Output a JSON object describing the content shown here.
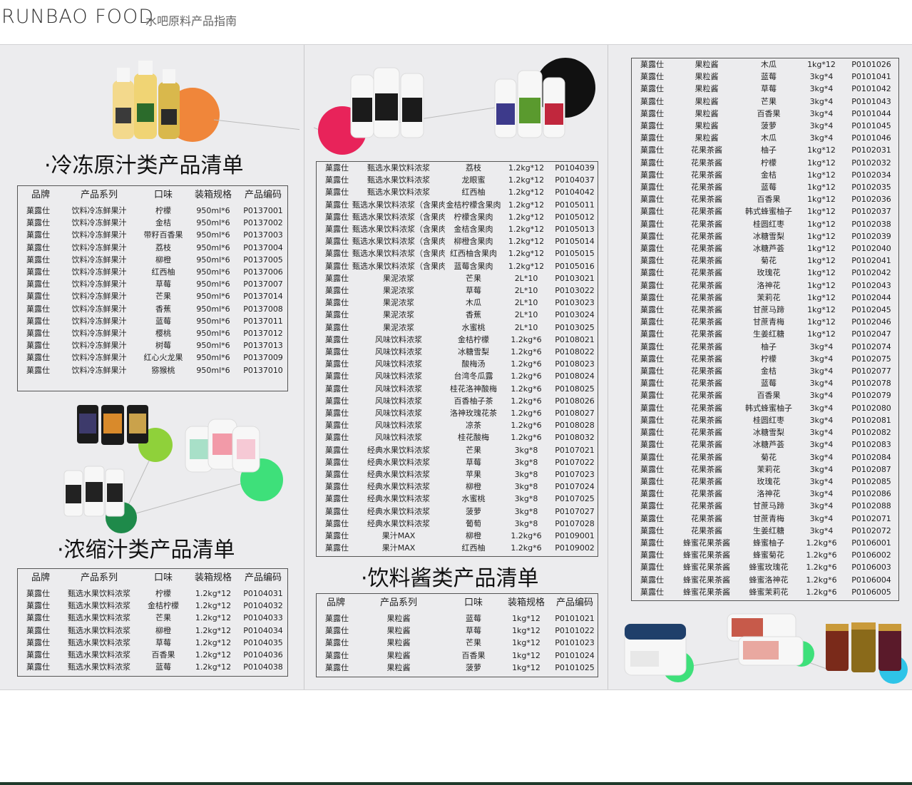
{
  "header": {
    "brand": "RUNBAO FOOD",
    "subtitle": "水吧原料产品指南"
  },
  "sections": {
    "frozen": {
      "title": "·冷冻原汁类产品清单",
      "headers": [
        "品牌",
        "产品系列",
        "口味",
        "装箱规格",
        "产品编码"
      ],
      "rows": [
        [
          "菓露仕",
          "饮料冷冻鲜果汁",
          "柠檬",
          "950ml*6",
          "P0137001"
        ],
        [
          "菓露仕",
          "饮料冷冻鲜果汁",
          "金桔",
          "950ml*6",
          "P0137002"
        ],
        [
          "菓露仕",
          "饮料冷冻鲜果汁",
          "带籽百香果",
          "950ml*6",
          "P0137003"
        ],
        [
          "菓露仕",
          "饮料冷冻鲜果汁",
          "荔枝",
          "950ml*6",
          "P0137004"
        ],
        [
          "菓露仕",
          "饮料冷冻鲜果汁",
          "柳橙",
          "950ml*6",
          "P0137005"
        ],
        [
          "菓露仕",
          "饮料冷冻鲜果汁",
          "红西柚",
          "950ml*6",
          "P0137006"
        ],
        [
          "菓露仕",
          "饮料冷冻鲜果汁",
          "草莓",
          "950ml*6",
          "P0137007"
        ],
        [
          "菓露仕",
          "饮料冷冻鲜果汁",
          "芒果",
          "950ml*6",
          "P0137014"
        ],
        [
          "菓露仕",
          "饮料冷冻鲜果汁",
          "香蕉",
          "950ml*6",
          "P0137008"
        ],
        [
          "菓露仕",
          "饮料冷冻鲜果汁",
          "蓝莓",
          "950ml*6",
          "P0137011"
        ],
        [
          "菓露仕",
          "饮料冷冻鲜果汁",
          "樱桃",
          "950ml*6",
          "P0137012"
        ],
        [
          "菓露仕",
          "饮料冷冻鲜果汁",
          "树莓",
          "950ml*6",
          "P0137013"
        ],
        [
          "菓露仕",
          "饮料冷冻鲜果汁",
          "红心火龙果",
          "950ml*6",
          "P0137009"
        ],
        [
          "菓露仕",
          "饮料冷冻鲜果汁",
          "猕猴桃",
          "950ml*6",
          "P0137010"
        ]
      ]
    },
    "concentrate": {
      "title": "·浓缩汁类产品清单",
      "headers": [
        "品牌",
        "产品系列",
        "口味",
        "装箱规格",
        "产品编码"
      ],
      "rows": [
        [
          "菓露仕",
          "甄选水果饮料浓浆",
          "柠檬",
          "1.2kg*12",
          "P0104031"
        ],
        [
          "菓露仕",
          "甄选水果饮料浓浆",
          "金桔柠檬",
          "1.2kg*12",
          "P0104032"
        ],
        [
          "菓露仕",
          "甄选水果饮料浓浆",
          "芒果",
          "1.2kg*12",
          "P0104033"
        ],
        [
          "菓露仕",
          "甄选水果饮料浓浆",
          "柳橙",
          "1.2kg*12",
          "P0104034"
        ],
        [
          "菓露仕",
          "甄选水果饮料浓浆",
          "草莓",
          "1.2kg*12",
          "P0104035"
        ],
        [
          "菓露仕",
          "甄选水果饮料浓浆",
          "百香果",
          "1.2kg*12",
          "P0104036"
        ],
        [
          "菓露仕",
          "甄选水果饮料浓浆",
          "蓝莓",
          "1.2kg*12",
          "P0104038"
        ]
      ]
    },
    "middle": {
      "rows": [
        [
          "菓露仕",
          "甄选水果饮料浓浆",
          "荔枝",
          "1.2kg*12",
          "P0104039"
        ],
        [
          "菓露仕",
          "甄选水果饮料浓浆",
          "龙眼蜜",
          "1.2kg*12",
          "P0104037"
        ],
        [
          "菓露仕",
          "甄选水果饮料浓浆",
          "红西柚",
          "1.2kg*12",
          "P0104042"
        ],
        [
          "菓露仕",
          "甄选水果饮料浓浆（含果肉）",
          "金桔柠檬含果肉",
          "1.2kg*12",
          "P0105011"
        ],
        [
          "菓露仕",
          "甄选水果饮料浓浆（含果肉）",
          "柠檬含果肉",
          "1.2kg*12",
          "P0105012"
        ],
        [
          "菓露仕",
          "甄选水果饮料浓浆（含果肉）",
          "金桔含果肉",
          "1.2kg*12",
          "P0105013"
        ],
        [
          "菓露仕",
          "甄选水果饮料浓浆（含果肉）",
          "柳橙含果肉",
          "1.2kg*12",
          "P0105014"
        ],
        [
          "菓露仕",
          "甄选水果饮料浓浆（含果肉）",
          "红西柚含果肉",
          "1.2kg*12",
          "P0105015"
        ],
        [
          "菓露仕",
          "甄选水果饮料浓浆（含果肉）",
          "蓝莓含果肉",
          "1.2kg*12",
          "P0105016"
        ],
        [
          "菓露仕",
          "果泥浓浆",
          "芒果",
          "2L*10",
          "P0103021"
        ],
        [
          "菓露仕",
          "果泥浓浆",
          "草莓",
          "2L*10",
          "P0103022"
        ],
        [
          "菓露仕",
          "果泥浓浆",
          "木瓜",
          "2L*10",
          "P0103023"
        ],
        [
          "菓露仕",
          "果泥浓浆",
          "香蕉",
          "2L*10",
          "P0103024"
        ],
        [
          "菓露仕",
          "果泥浓浆",
          "水蜜桃",
          "2L*10",
          "P0103025"
        ],
        [
          "菓露仕",
          "风味饮料浓浆",
          "金桔柠檬",
          "1.2kg*6",
          "P0108021"
        ],
        [
          "菓露仕",
          "风味饮料浓浆",
          "冰糖雪梨",
          "1.2kg*6",
          "P0108022"
        ],
        [
          "菓露仕",
          "风味饮料浓浆",
          "酸梅汤",
          "1.2kg*6",
          "P0108023"
        ],
        [
          "菓露仕",
          "风味饮料浓浆",
          "台湾冬瓜露",
          "1.2kg*6",
          "P0108024"
        ],
        [
          "菓露仕",
          "风味饮料浓浆",
          "桂花洛神酸梅",
          "1.2kg*6",
          "P0108025"
        ],
        [
          "菓露仕",
          "风味饮料浓浆",
          "百香柚子茶",
          "1.2kg*6",
          "P0108026"
        ],
        [
          "菓露仕",
          "风味饮料浓浆",
          "洛神玫瑰花茶",
          "1.2kg*6",
          "P0108027"
        ],
        [
          "菓露仕",
          "风味饮料浓浆",
          "凉茶",
          "1.2kg*6",
          "P0108028"
        ],
        [
          "菓露仕",
          "风味饮料浓浆",
          "桂花酸梅",
          "1.2kg*6",
          "P0108032"
        ],
        [
          "菓露仕",
          "经典水果饮料浓浆",
          "芒果",
          "3kg*8",
          "P0107021"
        ],
        [
          "菓露仕",
          "经典水果饮料浓浆",
          "草莓",
          "3kg*8",
          "P0107022"
        ],
        [
          "菓露仕",
          "经典水果饮料浓浆",
          "苹果",
          "3kg*8",
          "P0107023"
        ],
        [
          "菓露仕",
          "经典水果饮料浓浆",
          "柳橙",
          "3kg*8",
          "P0107024"
        ],
        [
          "菓露仕",
          "经典水果饮料浓浆",
          "水蜜桃",
          "3kg*8",
          "P0107025"
        ],
        [
          "菓露仕",
          "经典水果饮料浓浆",
          "菠萝",
          "3kg*8",
          "P0107027"
        ],
        [
          "菓露仕",
          "经典水果饮料浓浆",
          "葡萄",
          "3kg*8",
          "P0107028"
        ],
        [
          "菓露仕",
          "果汁MAX",
          "柳橙",
          "1.2kg*6",
          "P0109001"
        ],
        [
          "菓露仕",
          "果汁MAX",
          "红西柚",
          "1.2kg*6",
          "P0109002"
        ]
      ]
    },
    "sauce": {
      "title": "·饮料酱类产品清单",
      "headers": [
        "品牌",
        "产品系列",
        "口味",
        "装箱规格",
        "产品编码"
      ],
      "rows": [
        [
          "菓露仕",
          "果粒酱",
          "蓝莓",
          "1kg*12",
          "P0101021"
        ],
        [
          "菓露仕",
          "果粒酱",
          "草莓",
          "1kg*12",
          "P0101022"
        ],
        [
          "菓露仕",
          "果粒酱",
          "芒果",
          "1kg*12",
          "P0101023"
        ],
        [
          "菓露仕",
          "果粒酱",
          "百香果",
          "1kg*12",
          "P0101024"
        ],
        [
          "菓露仕",
          "果粒酱",
          "菠萝",
          "1kg*12",
          "P0101025"
        ]
      ]
    },
    "right": {
      "rows": [
        [
          "菓露仕",
          "果粒酱",
          "木瓜",
          "1kg*12",
          "P0101026"
        ],
        [
          "菓露仕",
          "果粒酱",
          "蓝莓",
          "3kg*4",
          "P0101041"
        ],
        [
          "菓露仕",
          "果粒酱",
          "草莓",
          "3kg*4",
          "P0101042"
        ],
        [
          "菓露仕",
          "果粒酱",
          "芒果",
          "3kg*4",
          "P0101043"
        ],
        [
          "菓露仕",
          "果粒酱",
          "百香果",
          "3kg*4",
          "P0101044"
        ],
        [
          "菓露仕",
          "果粒酱",
          "菠萝",
          "3kg*4",
          "P0101045"
        ],
        [
          "菓露仕",
          "果粒酱",
          "木瓜",
          "3kg*4",
          "P0101046"
        ],
        [
          "菓露仕",
          "花果茶酱",
          "柚子",
          "1kg*12",
          "P0102031"
        ],
        [
          "菓露仕",
          "花果茶酱",
          "柠檬",
          "1kg*12",
          "P0102032"
        ],
        [
          "菓露仕",
          "花果茶酱",
          "金桔",
          "1kg*12",
          "P0102034"
        ],
        [
          "菓露仕",
          "花果茶酱",
          "蓝莓",
          "1kg*12",
          "P0102035"
        ],
        [
          "菓露仕",
          "花果茶酱",
          "百香果",
          "1kg*12",
          "P0102036"
        ],
        [
          "菓露仕",
          "花果茶酱",
          "韩式蜂蜜柚子",
          "1kg*12",
          "P0102037"
        ],
        [
          "菓露仕",
          "花果茶酱",
          "桂圆红枣",
          "1kg*12",
          "P0102038"
        ],
        [
          "菓露仕",
          "花果茶酱",
          "冰糖雪梨",
          "1kg*12",
          "P0102039"
        ],
        [
          "菓露仕",
          "花果茶酱",
          "冰糖芦荟",
          "1kg*12",
          "P0102040"
        ],
        [
          "菓露仕",
          "花果茶酱",
          "菊花",
          "1kg*12",
          "P0102041"
        ],
        [
          "菓露仕",
          "花果茶酱",
          "玫瑰花",
          "1kg*12",
          "P0102042"
        ],
        [
          "菓露仕",
          "花果茶酱",
          "洛神花",
          "1kg*12",
          "P0102043"
        ],
        [
          "菓露仕",
          "花果茶酱",
          "茉莉花",
          "1kg*12",
          "P0102044"
        ],
        [
          "菓露仕",
          "花果茶酱",
          "甘蔗马蹄",
          "1kg*12",
          "P0102045"
        ],
        [
          "菓露仕",
          "花果茶酱",
          "甘蔗青梅",
          "1kg*12",
          "P0102046"
        ],
        [
          "菓露仕",
          "花果茶酱",
          "生姜红糖",
          "1kg*12",
          "P0102047"
        ],
        [
          "菓露仕",
          "花果茶酱",
          "柚子",
          "3kg*4",
          "P0102074"
        ],
        [
          "菓露仕",
          "花果茶酱",
          "柠檬",
          "3kg*4",
          "P0102075"
        ],
        [
          "菓露仕",
          "花果茶酱",
          "金桔",
          "3kg*4",
          "P0102077"
        ],
        [
          "菓露仕",
          "花果茶酱",
          "蓝莓",
          "3kg*4",
          "P0102078"
        ],
        [
          "菓露仕",
          "花果茶酱",
          "百香果",
          "3kg*4",
          "P0102079"
        ],
        [
          "菓露仕",
          "花果茶酱",
          "韩式蜂蜜柚子",
          "3kg*4",
          "P0102080"
        ],
        [
          "菓露仕",
          "花果茶酱",
          "桂圆红枣",
          "3kg*4",
          "P0102081"
        ],
        [
          "菓露仕",
          "花果茶酱",
          "冰糖雪梨",
          "3kg*4",
          "P0102082"
        ],
        [
          "菓露仕",
          "花果茶酱",
          "冰糖芦荟",
          "3kg*4",
          "P0102083"
        ],
        [
          "菓露仕",
          "花果茶酱",
          "菊花",
          "3kg*4",
          "P0102084"
        ],
        [
          "菓露仕",
          "花果茶酱",
          "茉莉花",
          "3kg*4",
          "P0102087"
        ],
        [
          "菓露仕",
          "花果茶酱",
          "玫瑰花",
          "3kg*4",
          "P0102085"
        ],
        [
          "菓露仕",
          "花果茶酱",
          "洛神花",
          "3kg*4",
          "P0102086"
        ],
        [
          "菓露仕",
          "花果茶酱",
          "甘蔗马蹄",
          "3kg*4",
          "P0102088"
        ],
        [
          "菓露仕",
          "花果茶酱",
          "甘蔗青梅",
          "3kg*4",
          "P0102071"
        ],
        [
          "菓露仕",
          "花果茶酱",
          "生姜红糖",
          "3kg*4",
          "P0102072"
        ],
        [
          "菓露仕",
          "蜂蜜花果茶酱",
          "蜂蜜柚子",
          "1.2kg*6",
          "P0106001"
        ],
        [
          "菓露仕",
          "蜂蜜花果茶酱",
          "蜂蜜菊花",
          "1.2kg*6",
          "P0106002"
        ],
        [
          "菓露仕",
          "蜂蜜花果茶酱",
          "蜂蜜玫瑰花",
          "1.2kg*6",
          "P0106003"
        ],
        [
          "菓露仕",
          "蜂蜜花果茶酱",
          "蜂蜜洛神花",
          "1.2kg*6",
          "P0106004"
        ],
        [
          "菓露仕",
          "蜂蜜花果茶酱",
          "蜂蜜茉莉花",
          "1.2kg*6",
          "P0106005"
        ]
      ]
    }
  },
  "colors": {
    "orange": "#f0863a",
    "pink": "#e8235a",
    "black": "#111111",
    "lime": "#8fd13a",
    "green": "#1e8a4a",
    "mint": "#3ee07a",
    "cyan": "#2ec4e8",
    "panel": "#ececee"
  }
}
